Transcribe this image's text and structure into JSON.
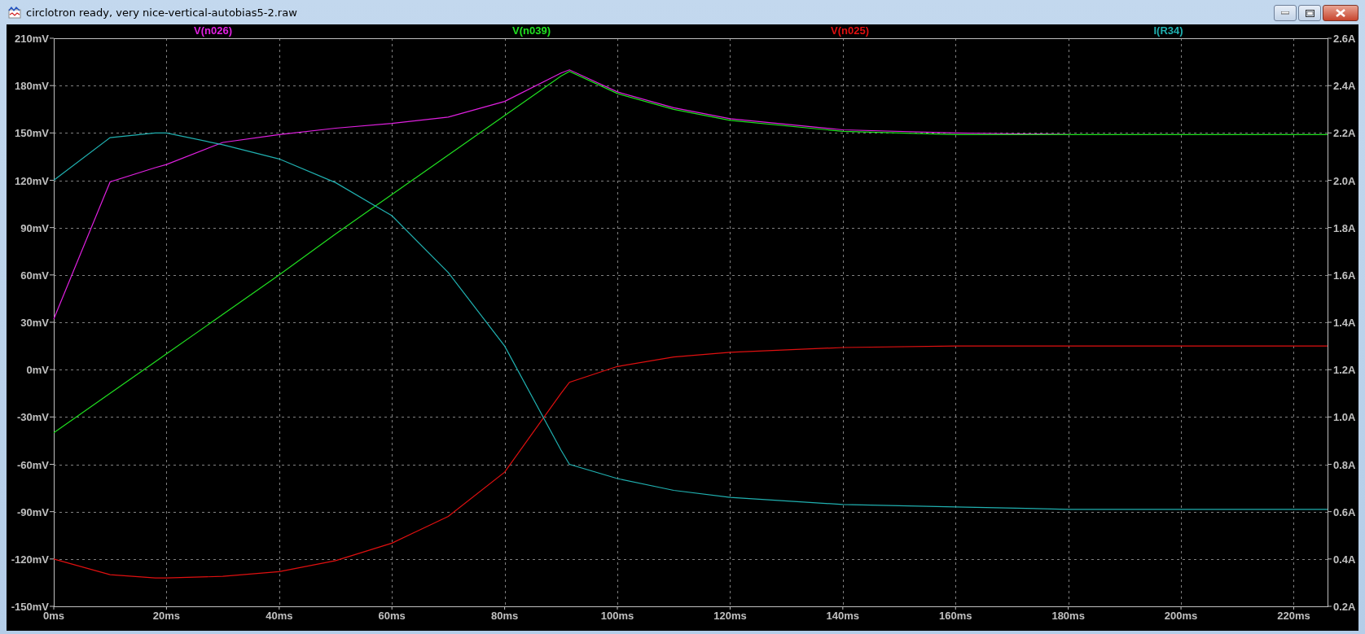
{
  "window": {
    "title": "circlotron ready, very nice-vertical-autobias5-2.raw"
  },
  "plot": {
    "chart_data": {
      "type": "line",
      "x": [
        0,
        10,
        18,
        20,
        30,
        40,
        50,
        60,
        70,
        80,
        90,
        91.5,
        100,
        110,
        120,
        140,
        160,
        180,
        200,
        226
      ],
      "series": [
        {
          "name": "V(n026)",
          "color": "#e020e0",
          "values": [
            32,
            119,
            128,
            130,
            144,
            149,
            153,
            156,
            160,
            170,
            188,
            190,
            176,
            166,
            159,
            152,
            150,
            149,
            null,
            null
          ]
        },
        {
          "name": "V(n039)",
          "color": "#20e020",
          "values": [
            -40,
            -15,
            5,
            10,
            35,
            60,
            86,
            111,
            136,
            161,
            186,
            189,
            175,
            165,
            158,
            151,
            149,
            149,
            149,
            149
          ]
        },
        {
          "name": "V(n025)",
          "color": "#e01010",
          "values": [
            -120,
            -130,
            -132,
            -132,
            -131,
            -128,
            -121,
            -110,
            -93,
            -65,
            -15,
            -8,
            2,
            8,
            11,
            14,
            15,
            15,
            15,
            15
          ]
        },
        {
          "name": "I(R34)",
          "color": "#20b0b0",
          "axis": "y2",
          "values": [
            2.0,
            2.18,
            2.2,
            2.2,
            2.15,
            2.09,
            1.99,
            1.85,
            1.61,
            1.3,
            0.86,
            0.8,
            0.74,
            0.69,
            0.66,
            0.63,
            0.62,
            0.61,
            0.61,
            0.61
          ]
        }
      ],
      "grid": true,
      "xlim": [
        0,
        226
      ],
      "ylim": [
        -150,
        210
      ],
      "y2lim": [
        0.2,
        2.6
      ],
      "xticks": [
        {
          "value": 0,
          "label": "0ms"
        },
        {
          "value": 20,
          "label": "20ms"
        },
        {
          "value": 40,
          "label": "40ms"
        },
        {
          "value": 60,
          "label": "60ms"
        },
        {
          "value": 80,
          "label": "80ms"
        },
        {
          "value": 100,
          "label": "100ms"
        },
        {
          "value": 120,
          "label": "120ms"
        },
        {
          "value": 140,
          "label": "140ms"
        },
        {
          "value": 160,
          "label": "160ms"
        },
        {
          "value": 180,
          "label": "180ms"
        },
        {
          "value": 200,
          "label": "200ms"
        },
        {
          "value": 220,
          "label": "220ms"
        }
      ],
      "yticks": [
        {
          "value": -150,
          "label": "-150mV"
        },
        {
          "value": -120,
          "label": "-120mV"
        },
        {
          "value": -90,
          "label": "-90mV"
        },
        {
          "value": -60,
          "label": "-60mV"
        },
        {
          "value": -30,
          "label": "-30mV"
        },
        {
          "value": 0,
          "label": "0mV"
        },
        {
          "value": 30,
          "label": "30mV"
        },
        {
          "value": 60,
          "label": "60mV"
        },
        {
          "value": 90,
          "label": "90mV"
        },
        {
          "value": 120,
          "label": "120mV"
        },
        {
          "value": 150,
          "label": "150mV"
        },
        {
          "value": 180,
          "label": "180mV"
        },
        {
          "value": 210,
          "label": "210mV"
        }
      ],
      "y2ticks": [
        {
          "value": 0.2,
          "label": "0.2A"
        },
        {
          "value": 0.4,
          "label": "0.4A"
        },
        {
          "value": 0.6,
          "label": "0.6A"
        },
        {
          "value": 0.8,
          "label": "0.8A"
        },
        {
          "value": 1.0,
          "label": "1.0A"
        },
        {
          "value": 1.2,
          "label": "1.2A"
        },
        {
          "value": 1.4,
          "label": "1.4A"
        },
        {
          "value": 1.6,
          "label": "1.6A"
        },
        {
          "value": 1.8,
          "label": "1.8A"
        },
        {
          "value": 2.0,
          "label": "2.0A"
        },
        {
          "value": 2.2,
          "label": "2.2A"
        },
        {
          "value": 2.4,
          "label": "2.4A"
        },
        {
          "value": 2.6,
          "label": "2.6A"
        }
      ]
    }
  }
}
